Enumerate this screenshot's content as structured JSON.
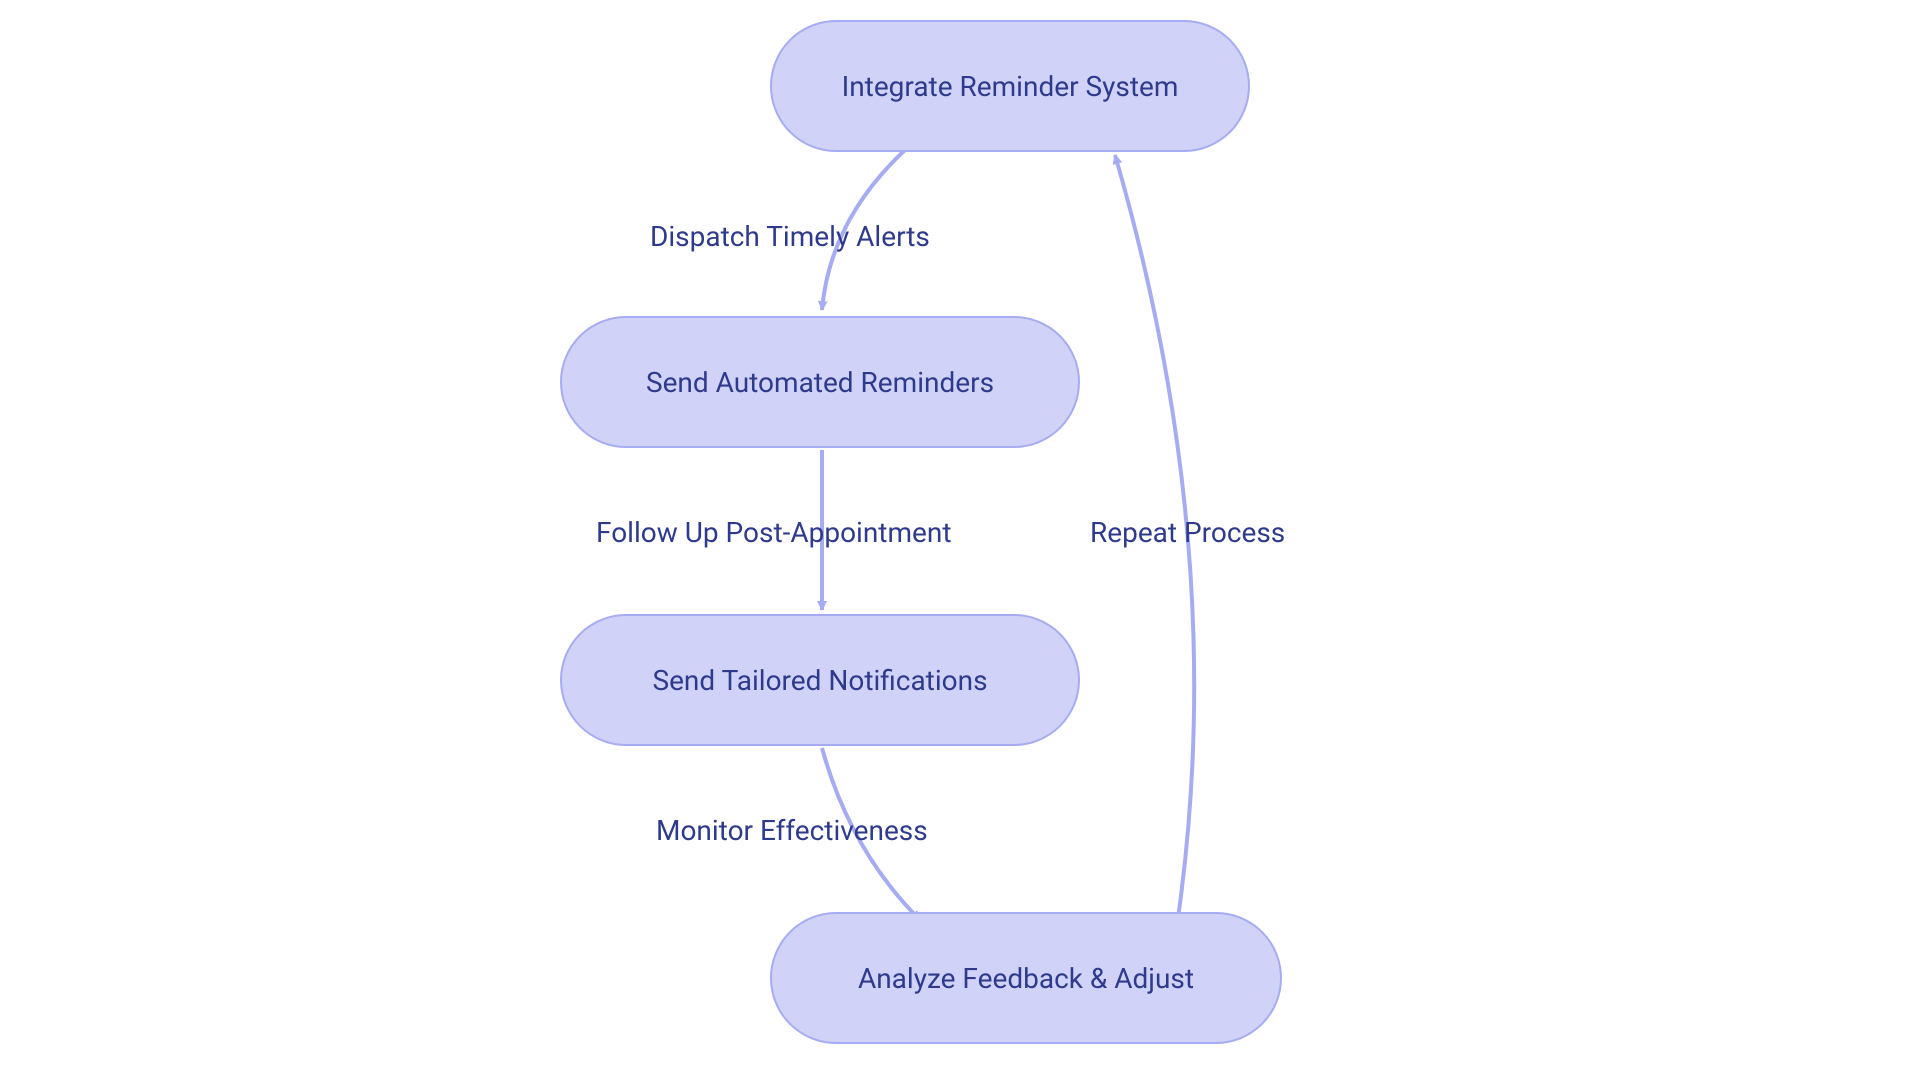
{
  "nodes": {
    "n1": {
      "label": "Integrate Reminder System"
    },
    "n2": {
      "label": "Send Automated Reminders"
    },
    "n3": {
      "label": "Send Tailored Notifications"
    },
    "n4": {
      "label": "Analyze Feedback & Adjust"
    }
  },
  "edges": {
    "e1": {
      "label": "Dispatch Timely Alerts"
    },
    "e2": {
      "label": "Follow Up Post-Appointment"
    },
    "e3": {
      "label": "Monitor Effectiveness"
    },
    "e4": {
      "label": "Repeat Process"
    }
  },
  "colors": {
    "nodeFill": "#d0d3f7",
    "nodeStroke": "#a6acf2",
    "text": "#2e3a8c",
    "arrow": "#a6acf2"
  }
}
